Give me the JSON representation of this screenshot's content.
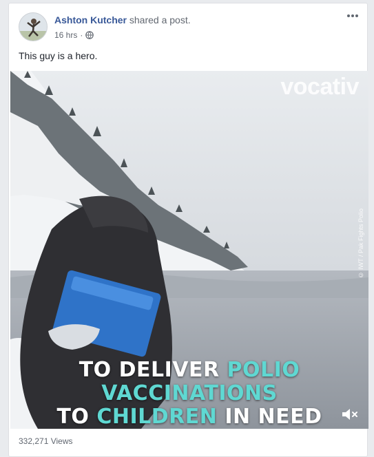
{
  "post": {
    "author": "Ashton Kutcher",
    "action": " shared a post.",
    "time": "16 hrs",
    "separator": "·",
    "privacy_icon": "globe-icon",
    "text": "This guy is a hero."
  },
  "video": {
    "brand": "vocativ",
    "credit": "© IWT / Pak Fights Polio",
    "caption": {
      "line1": {
        "a": "TO DELIVER ",
        "b": "POLIO"
      },
      "line2": {
        "a": "VACCINATIONS"
      },
      "line3": {
        "a": "TO ",
        "b": "CHILDREN",
        "c": " IN NEED"
      }
    },
    "mute_icon": "speaker-muted-icon"
  },
  "stats": {
    "views": "332,271 Views"
  },
  "colors": {
    "link": "#385898",
    "highlight": "#5fd8d2"
  }
}
